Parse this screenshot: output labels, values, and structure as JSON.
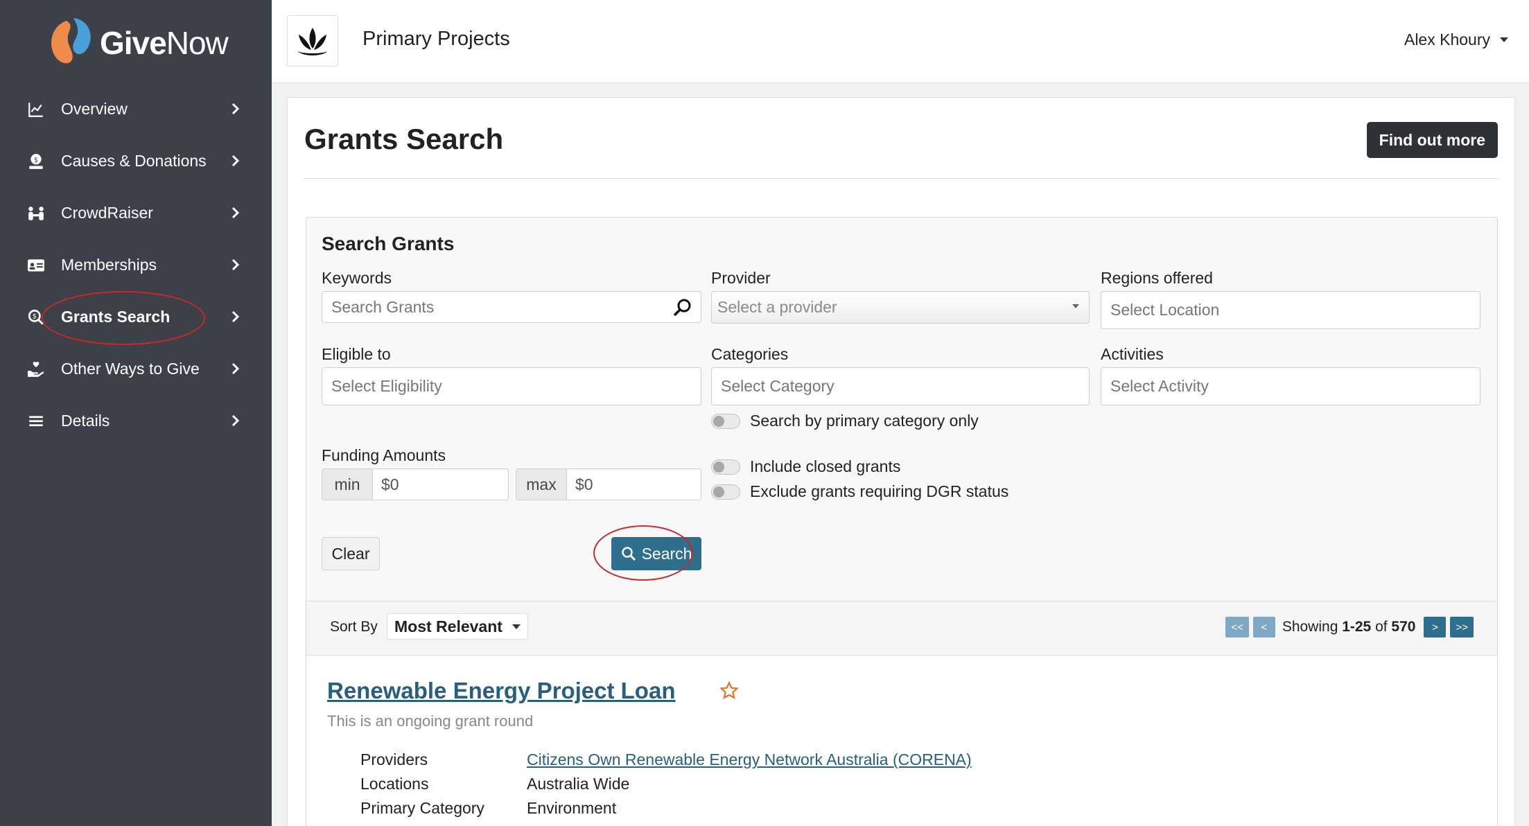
{
  "brand": {
    "name_bold": "Give",
    "name_light": "Now",
    "accent": "#4a9fd8",
    "accent2": "#f08a4b"
  },
  "sidebar": {
    "items": [
      {
        "label": "Overview",
        "icon": "chart-line-icon"
      },
      {
        "label": "Causes & Donations",
        "icon": "donation-icon"
      },
      {
        "label": "CrowdRaiser",
        "icon": "people-icon"
      },
      {
        "label": "Memberships",
        "icon": "id-card-icon"
      },
      {
        "label": "Grants Search",
        "icon": "search-dollar-icon",
        "active": true
      },
      {
        "label": "Other Ways to Give",
        "icon": "hand-heart-icon"
      },
      {
        "label": "Details",
        "icon": "list-icon"
      }
    ]
  },
  "header": {
    "org_name": "Primary Projects",
    "user": "Alex Khoury"
  },
  "page": {
    "title": "Grants Search",
    "find_out_more": "Find out more"
  },
  "search": {
    "title": "Search Grants",
    "keywords": {
      "label": "Keywords",
      "placeholder": "Search Grants"
    },
    "provider": {
      "label": "Provider",
      "placeholder": "Select a provider"
    },
    "regions": {
      "label": "Regions offered",
      "placeholder": "Select Location"
    },
    "eligible": {
      "label": "Eligible to",
      "placeholder": "Select Eligibility"
    },
    "categories": {
      "label": "Categories",
      "placeholder": "Select Category"
    },
    "activities": {
      "label": "Activities",
      "placeholder": "Select Activity"
    },
    "primary_only": "Search by primary category only",
    "funding": {
      "label": "Funding Amounts",
      "min_label": "min",
      "min_value": "$0",
      "max_label": "max",
      "max_value": "$0"
    },
    "include_closed": "Include closed grants",
    "exclude_dgr": "Exclude grants requiring DGR status",
    "clear": "Clear",
    "search_button": "Search"
  },
  "results": {
    "sort_label": "Sort By",
    "sort_value": "Most Relevant",
    "pager": {
      "first": "<<",
      "prev": "<",
      "showing_prefix": "Showing ",
      "range": "1-25",
      "of": " of ",
      "total": "570",
      "next": ">",
      "last": ">>"
    },
    "grants": [
      {
        "title": "Renewable Energy Project Loan",
        "subtitle": "This is an ongoing grant round",
        "providers_label": "Providers",
        "providers": "Citizens Own Renewable Energy Network Australia (CORENA)",
        "locations_label": "Locations",
        "locations": "Australia Wide",
        "category_label": "Primary Category",
        "category": "Environment"
      }
    ]
  }
}
